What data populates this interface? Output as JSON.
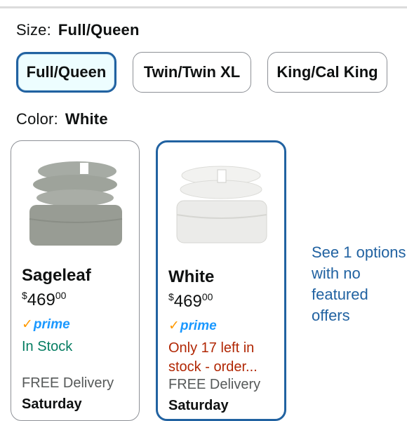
{
  "size": {
    "label": "Size:",
    "selected": "Full/Queen",
    "options": [
      "Full/Queen",
      "Twin/Twin XL",
      "King/Cal King"
    ]
  },
  "color": {
    "label": "Color:",
    "selected": "White",
    "cards": [
      {
        "name": "Sageleaf",
        "price_symbol": "$",
        "price_whole": "469",
        "price_cents": "00",
        "prime": "prime",
        "stock": "In Stock",
        "delivery": "FREE Delivery",
        "day": "Saturday",
        "product_color": "#9ea39b"
      },
      {
        "name": "White",
        "price_symbol": "$",
        "price_whole": "469",
        "price_cents": "00",
        "prime": "prime",
        "stock": "Only 17 left in stock - order...",
        "delivery": "FREE Delivery",
        "day": "Saturday",
        "product_color": "#eeeeec"
      }
    ],
    "see_options": "See 1 options with no featured offers"
  },
  "colors": {
    "accent": "#2162a1",
    "prime_blue": "#1a98ff",
    "in_stock": "#067d62",
    "low_stock": "#b12704"
  }
}
